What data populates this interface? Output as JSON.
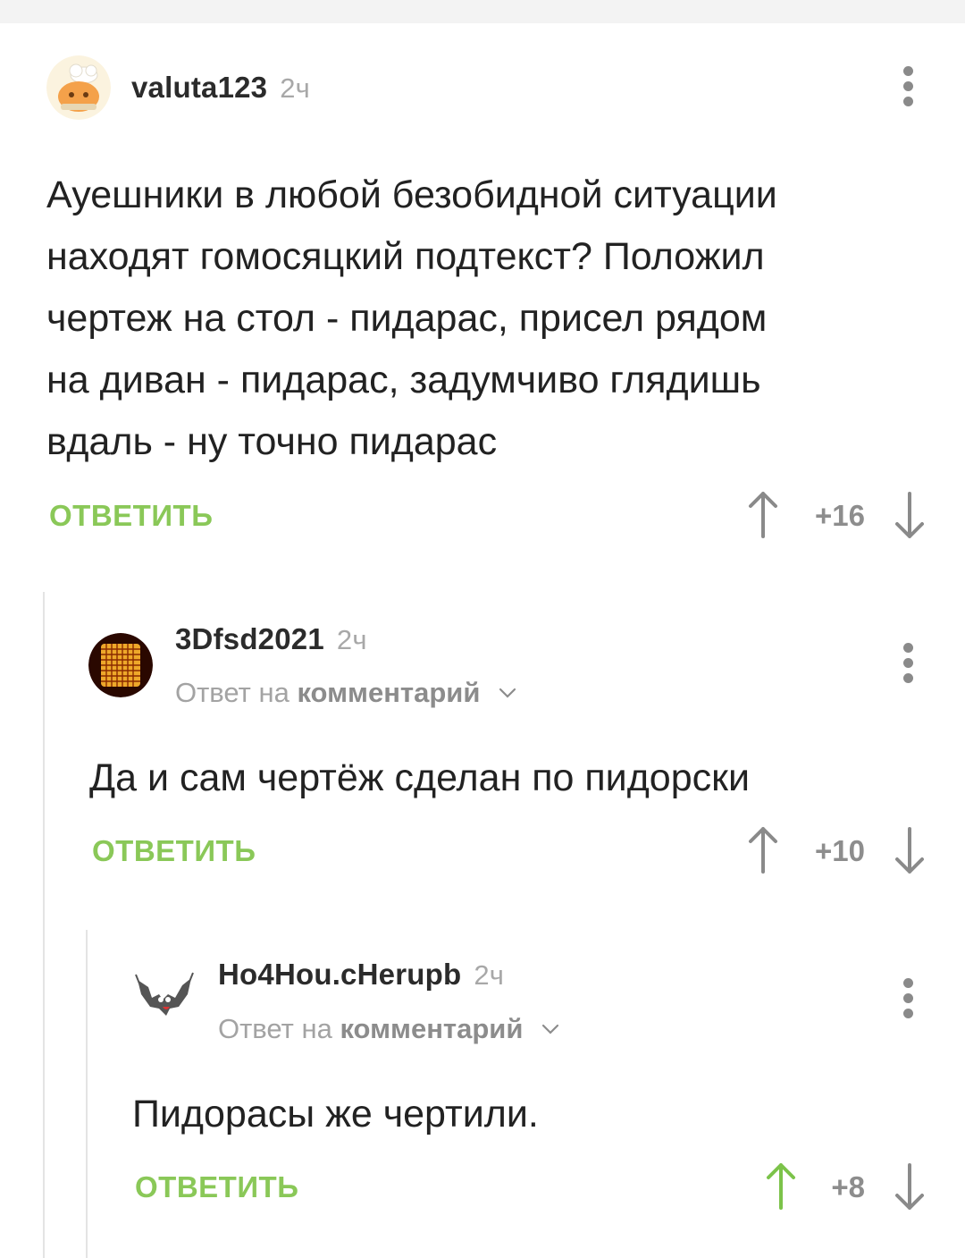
{
  "comments": [
    {
      "author": "valuta123",
      "time": "2ч",
      "text_lines": [
        "Ауешники в любой безобидной ситуации",
        "находят гомосяцкий подтекст? Положил",
        "чертеж на стол - пидарас, присел рядом",
        "на диван - пидарас, задумчиво глядишь",
        "вдаль - ну точно пидарас"
      ],
      "reply_label": "ОТВЕТИТЬ",
      "score": "+16",
      "upvoted": false
    },
    {
      "author": "3Dfsd2021",
      "time": "2ч",
      "reply_prefix": "Ответ на",
      "reply_link": "комментарий",
      "text": "Да и сам чертёж сделан по пидорски",
      "reply_label": "ОТВЕТИТЬ",
      "score": "+10",
      "upvoted": false
    },
    {
      "author": "Ho4Hou.cHerupb",
      "time": "2ч",
      "reply_prefix": "Ответ на",
      "reply_link": "комментарий",
      "text": "Пидорасы же чертили.",
      "reply_label": "ОТВЕТИТЬ",
      "score": "+8",
      "upvoted": true
    }
  ],
  "icons": {
    "more": "more-vertical-icon",
    "upvote": "arrow-up-icon",
    "downvote": "arrow-down-icon",
    "expand": "chevron-down-icon"
  },
  "colors": {
    "accent": "#8ac858",
    "vote_idle": "#8a8a8a",
    "vote_active": "#7cc34a",
    "thread_line": "#e4e4e4"
  }
}
